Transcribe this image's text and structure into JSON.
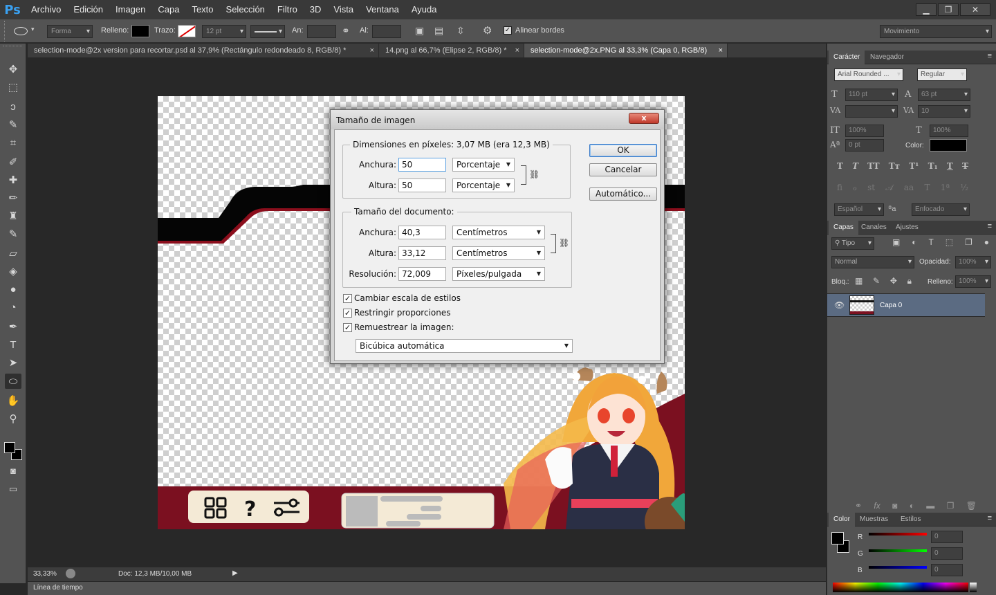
{
  "app": {
    "logo": "Ps"
  },
  "menu": [
    "Archivo",
    "Edición",
    "Imagen",
    "Capa",
    "Texto",
    "Selección",
    "Filtro",
    "3D",
    "Vista",
    "Ventana",
    "Ayuda"
  ],
  "window_controls": {
    "minimize": "▁",
    "restore": "❐",
    "close": "✕"
  },
  "options_bar": {
    "shape_mode": "Forma",
    "fill_label": "Relleno:",
    "stroke_label": "Trazo:",
    "stroke_size": "12 pt",
    "width_label": "An:",
    "height_label": "Al:",
    "align_edges_label": "Alinear bordes",
    "align_edges_checked": true,
    "workspace": "Movimiento"
  },
  "tabs": [
    {
      "label": "selection-mode@2x version para recortar.psd al 37,9% (Rectángulo redondeado 8, RGB/8) *",
      "close": "×",
      "active": false
    },
    {
      "label": "14.png al 66,7% (Elipse 2, RGB/8) *",
      "close": "×",
      "active": false
    },
    {
      "label": "selection-mode@2x.PNG al 33,3% (Capa 0, RGB/8)",
      "close": "×",
      "active": true
    }
  ],
  "tools": [
    {
      "name": "move-tool",
      "glyph": "✥"
    },
    {
      "name": "marquee-tool",
      "glyph": "⬚"
    },
    {
      "name": "lasso-tool",
      "glyph": "ↄ"
    },
    {
      "name": "quick-select-tool",
      "glyph": "✎"
    },
    {
      "name": "crop-tool",
      "glyph": "⌗"
    },
    {
      "name": "eyedropper-tool",
      "glyph": "✐"
    },
    {
      "name": "healing-brush-tool",
      "glyph": "✚"
    },
    {
      "name": "brush-tool",
      "glyph": "✏"
    },
    {
      "name": "clone-stamp-tool",
      "glyph": "♜"
    },
    {
      "name": "history-brush-tool",
      "glyph": "✎"
    },
    {
      "name": "eraser-tool",
      "glyph": "▱"
    },
    {
      "name": "paint-bucket-tool",
      "glyph": "◈"
    },
    {
      "name": "blur-tool",
      "glyph": "●"
    },
    {
      "name": "dodge-tool",
      "glyph": "◔"
    },
    {
      "name": "pen-tool",
      "glyph": "✒"
    },
    {
      "name": "type-tool",
      "glyph": "T"
    },
    {
      "name": "path-select-tool",
      "glyph": "➤"
    },
    {
      "name": "ellipse-tool",
      "glyph": "⬭"
    },
    {
      "name": "hand-tool",
      "glyph": "✋"
    },
    {
      "name": "zoom-tool",
      "glyph": "⚲"
    }
  ],
  "dialog": {
    "title": "Tamaño de imagen",
    "close": "x",
    "pixel_group": "Dimensiones en píxeles: 3,07 MB (era 12,3 MB)",
    "pixel_width_label": "Anchura:",
    "pixel_width_value": "50",
    "pixel_width_unit": "Porcentaje",
    "pixel_height_label": "Altura:",
    "pixel_height_value": "50",
    "pixel_height_unit": "Porcentaje",
    "doc_group": "Tamaño del documento:",
    "doc_width_label": "Anchura:",
    "doc_width_value": "40,3",
    "doc_width_unit": "Centímetros",
    "doc_height_label": "Altura:",
    "doc_height_value": "33,12",
    "doc_height_unit": "Centímetros",
    "resolution_label": "Resolución:",
    "resolution_value": "72,009",
    "resolution_unit": "Píxeles/pulgada",
    "scale_styles": "Cambiar escala de estilos",
    "constrain": "Restringir proporciones",
    "resample": "Remuestrear la imagen:",
    "resample_method": "Bicúbica automática",
    "ok": "OK",
    "cancel": "Cancelar",
    "auto": "Automático..."
  },
  "status": {
    "zoom": "33,33%",
    "doc": "Doc: 12,3 MB/10,00 MB"
  },
  "timeline": "Línea de tiempo",
  "character_panel": {
    "tabs": [
      "Carácter",
      "Navegador"
    ],
    "font": "Arial Rounded ...",
    "style": "Regular",
    "size": "110 pt",
    "leading": "63 pt",
    "kerning": "",
    "tracking": "10",
    "vscale": "100%",
    "hscale": "100%",
    "baseline": "0 pt",
    "color_label": "Color:",
    "language": "Español",
    "antialias": "Enfocado"
  },
  "layers_panel": {
    "tabs": [
      "Capas",
      "Canales",
      "Ajustes"
    ],
    "filter": "Tipo",
    "blend_mode": "Normal",
    "opacity_label": "Opacidad:",
    "opacity": "100%",
    "lock_label": "Bloq.:",
    "fill_label": "Relleno:",
    "fill": "100%",
    "layers": [
      {
        "name": "Capa 0",
        "visible": true,
        "selected": true
      }
    ]
  },
  "color_panel": {
    "tabs": [
      "Color",
      "Muestras",
      "Estilos"
    ],
    "channels": [
      {
        "label": "R",
        "value": "0"
      },
      {
        "label": "G",
        "value": "0"
      },
      {
        "label": "B",
        "value": "0"
      }
    ]
  }
}
